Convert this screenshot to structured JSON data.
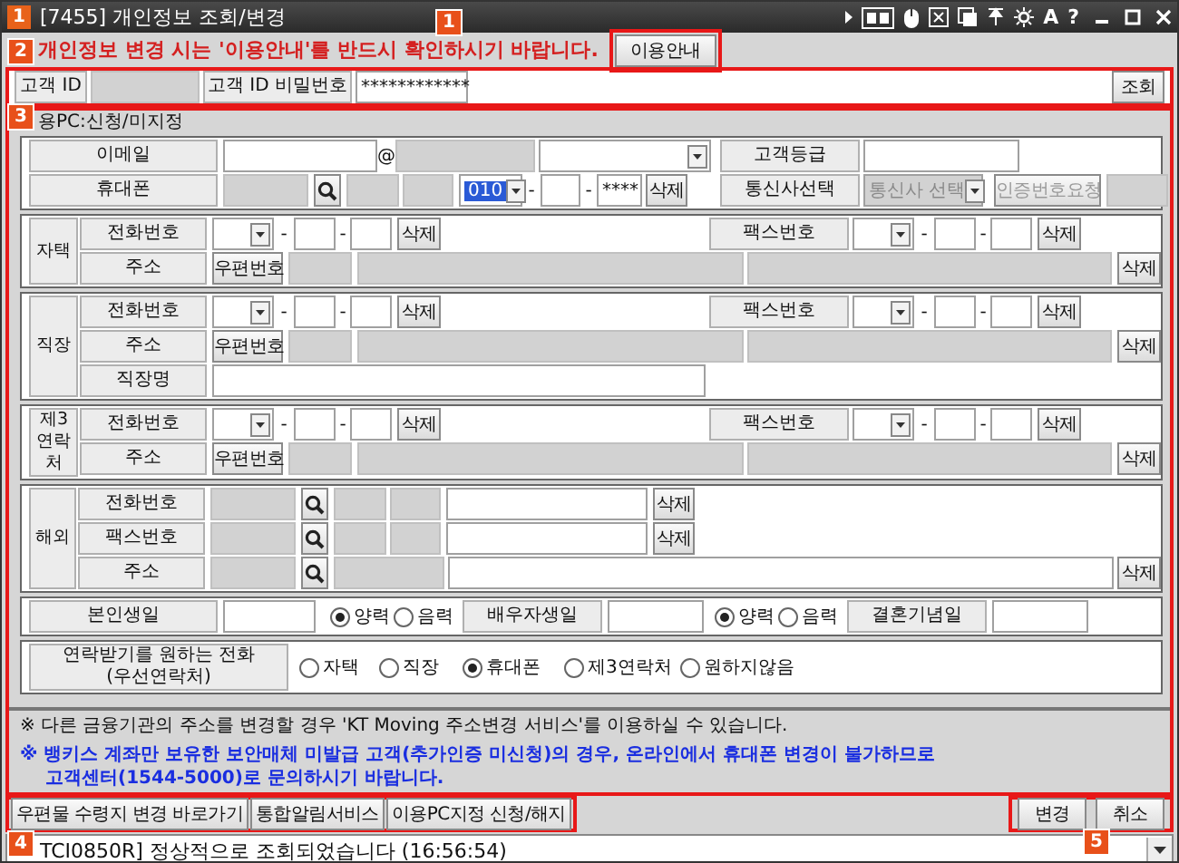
{
  "window": {
    "icon_text": "1",
    "title": "[7455] 개인정보 조회/변경",
    "glyph_buttons": [
      "A",
      "?"
    ]
  },
  "notice": {
    "text": "개인정보 변경 시는 '이용안내'를 반드시 확인하시기 바랍니다.",
    "button": "이용안내"
  },
  "login": {
    "id_label": "고객 ID",
    "password_label": "고객 ID 비밀번호",
    "password_value": "************",
    "search_button": "조회"
  },
  "pc_status": "용PC:신청/미지정",
  "sections": [
    {
      "rows": [
        {
          "cells": [
            {
              "kind": "label",
              "text": "이메일"
            },
            {
              "kind": "field"
            },
            {
              "kind": "text",
              "text": "@"
            },
            {
              "kind": "grey-field"
            },
            {
              "kind": "select"
            }
          ],
          "right_cells": [
            {
              "kind": "label",
              "text": "고객등급"
            },
            {
              "kind": "field"
            }
          ]
        },
        {
          "cells": [
            {
              "kind": "label",
              "text": "휴대폰"
            },
            {
              "kind": "grey-field"
            },
            {
              "kind": "search-button"
            },
            {
              "kind": "grey-field"
            },
            {
              "kind": "grey-field"
            },
            {
              "kind": "select",
              "value": "010",
              "focused": true
            },
            {
              "kind": "text",
              "text": "-"
            },
            {
              "kind": "field"
            },
            {
              "kind": "text",
              "text": "-"
            },
            {
              "kind": "field",
              "value": "****"
            },
            {
              "kind": "button",
              "text": "삭제"
            }
          ],
          "right_cells": [
            {
              "kind": "label",
              "text": "통신사선택"
            },
            {
              "kind": "select",
              "value": "통신사 선택",
              "disabled": true
            },
            {
              "kind": "button",
              "text": "인증번호요청",
              "disabled": true
            },
            {
              "kind": "grey-field"
            }
          ]
        }
      ]
    },
    {
      "group": "자택",
      "rows": [
        {
          "cells": [
            {
              "kind": "label",
              "text": "전화번호"
            },
            {
              "kind": "select"
            },
            {
              "kind": "text",
              "text": "-"
            },
            {
              "kind": "field"
            },
            {
              "kind": "text",
              "text": "-"
            },
            {
              "kind": "field"
            },
            {
              "kind": "button",
              "text": "삭제"
            },
            {
              "kind": "label",
              "text": "팩스번호"
            },
            {
              "kind": "select"
            },
            {
              "kind": "text",
              "text": "-"
            },
            {
              "kind": "field"
            },
            {
              "kind": "text",
              "text": "-"
            },
            {
              "kind": "field"
            },
            {
              "kind": "button",
              "text": "삭제"
            }
          ]
        },
        {
          "cells": [
            {
              "kind": "label",
              "text": "주소"
            },
            {
              "kind": "button",
              "text": "우편번호"
            },
            {
              "kind": "grey-field"
            },
            {
              "kind": "grey-field"
            },
            {
              "kind": "grey-field"
            },
            {
              "kind": "button",
              "text": "삭제"
            }
          ]
        }
      ]
    },
    {
      "group": "직장",
      "rows": [
        {
          "cells": [
            {
              "kind": "label",
              "text": "전화번호"
            },
            {
              "kind": "select"
            },
            {
              "kind": "text",
              "text": "-"
            },
            {
              "kind": "field"
            },
            {
              "kind": "text",
              "text": "-"
            },
            {
              "kind": "field"
            },
            {
              "kind": "button",
              "text": "삭제"
            },
            {
              "kind": "label",
              "text": "팩스번호"
            },
            {
              "kind": "select"
            },
            {
              "kind": "text",
              "text": "-"
            },
            {
              "kind": "field"
            },
            {
              "kind": "text",
              "text": "-"
            },
            {
              "kind": "field"
            },
            {
              "kind": "button",
              "text": "삭제"
            }
          ]
        },
        {
          "cells": [
            {
              "kind": "label",
              "text": "주소"
            },
            {
              "kind": "button",
              "text": "우편번호"
            },
            {
              "kind": "grey-field"
            },
            {
              "kind": "grey-field"
            },
            {
              "kind": "grey-field"
            },
            {
              "kind": "button",
              "text": "삭제"
            }
          ]
        },
        {
          "cells": [
            {
              "kind": "label",
              "text": "직장명"
            },
            {
              "kind": "field"
            }
          ]
        }
      ]
    },
    {
      "group": "제3\n연락처",
      "rows": [
        {
          "cells": [
            {
              "kind": "label",
              "text": "전화번호"
            },
            {
              "kind": "select"
            },
            {
              "kind": "text",
              "text": "-"
            },
            {
              "kind": "field"
            },
            {
              "kind": "text",
              "text": "-"
            },
            {
              "kind": "field"
            },
            {
              "kind": "button",
              "text": "삭제"
            },
            {
              "kind": "label",
              "text": "팩스번호"
            },
            {
              "kind": "select"
            },
            {
              "kind": "text",
              "text": "-"
            },
            {
              "kind": "field"
            },
            {
              "kind": "text",
              "text": "-"
            },
            {
              "kind": "field"
            },
            {
              "kind": "button",
              "text": "삭제"
            }
          ]
        },
        {
          "cells": [
            {
              "kind": "label",
              "text": "주소"
            },
            {
              "kind": "button",
              "text": "우편번호"
            },
            {
              "kind": "grey-field"
            },
            {
              "kind": "grey-field"
            },
            {
              "kind": "grey-field"
            },
            {
              "kind": "button",
              "text": "삭제"
            }
          ]
        }
      ]
    },
    {
      "group": "해외",
      "rows": [
        {
          "cells": [
            {
              "kind": "label",
              "text": "전화번호"
            },
            {
              "kind": "grey-field"
            },
            {
              "kind": "search-button"
            },
            {
              "kind": "grey-field"
            },
            {
              "kind": "grey-field"
            },
            {
              "kind": "field"
            },
            {
              "kind": "button",
              "text": "삭제"
            }
          ]
        },
        {
          "cells": [
            {
              "kind": "label",
              "text": "팩스번호"
            },
            {
              "kind": "grey-field"
            },
            {
              "kind": "search-button"
            },
            {
              "kind": "grey-field"
            },
            {
              "kind": "grey-field"
            },
            {
              "kind": "field"
            },
            {
              "kind": "button",
              "text": "삭제"
            }
          ]
        },
        {
          "cells": [
            {
              "kind": "label",
              "text": "주소"
            },
            {
              "kind": "grey-field"
            },
            {
              "kind": "search-button"
            },
            {
              "kind": "grey-field"
            },
            {
              "kind": "field"
            },
            {
              "kind": "button",
              "text": "삭제"
            }
          ]
        }
      ]
    },
    {
      "rows": [
        {
          "cells": [
            {
              "kind": "label",
              "text": "본인생일"
            },
            {
              "kind": "field"
            },
            {
              "kind": "radio",
              "text": "양력",
              "selected": true
            },
            {
              "kind": "radio",
              "text": "음력",
              "selected": false
            },
            {
              "kind": "label",
              "text": "배우자생일"
            },
            {
              "kind": "field"
            },
            {
              "kind": "radio",
              "text": "양력",
              "selected": true
            },
            {
              "kind": "radio",
              "text": "음력",
              "selected": false
            },
            {
              "kind": "label",
              "text": "결혼기념일"
            },
            {
              "kind": "field"
            }
          ]
        }
      ]
    },
    {
      "rows": [
        {
          "cells": [
            {
              "kind": "label",
              "text": "연락받기를 원하는 전화\n(우선연락처)"
            },
            {
              "kind": "radio",
              "text": "자택",
              "selected": false
            },
            {
              "kind": "radio",
              "text": "직장",
              "selected": false
            },
            {
              "kind": "radio",
              "text": "휴대폰",
              "selected": true
            },
            {
              "kind": "radio",
              "text": "제3연락처",
              "selected": false
            },
            {
              "kind": "radio",
              "text": "원하지않음",
              "selected": false
            }
          ]
        }
      ]
    }
  ],
  "notes": [
    {
      "kind": "plain",
      "text": "※ 다른 금융기관의 주소를 변경할 경우 'KT Moving 주소변경 서비스'를 이용하실 수 있습니다."
    },
    {
      "kind": "warning",
      "text": "※ 뱅키스 계좌만 보유한 보안매체 미발급 고객(추가인증 미신청)의 경우, 온라인에서 휴대폰 변경이 불가하므로\n고객센터(1544-5000)로 문의하시기 바랍니다."
    }
  ],
  "link_buttons": [
    "우편물 수령지 변경 바로가기",
    "통합알림서비스",
    "이용PC지정 신청/해지"
  ],
  "action_buttons": [
    "변경",
    "취소"
  ],
  "status_bar": {
    "message": "TCI0850R] 정상적으로 조회되었습니다 (16:56:54)"
  },
  "callouts": [
    "1",
    "2",
    "3",
    "4",
    "5"
  ]
}
